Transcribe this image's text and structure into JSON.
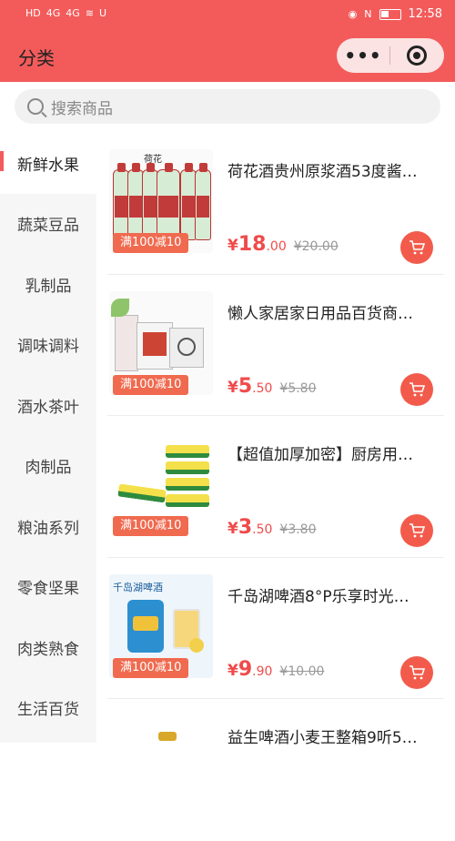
{
  "status_bar": {
    "left_icons": [
      "HD",
      "4G",
      "4G",
      "wifi",
      "U"
    ],
    "right_icons": [
      "eye",
      "N",
      "battery"
    ],
    "time": "12:58"
  },
  "header": {
    "title": "分类",
    "capsule_more_icon": "more-dots-icon",
    "capsule_target_icon": "target-icon",
    "bg_color": "#f35b5b"
  },
  "search": {
    "placeholder": "搜索商品"
  },
  "sidebar": {
    "active_index": 0,
    "items": [
      {
        "label": "新鲜水果"
      },
      {
        "label": "蔬菜豆品"
      },
      {
        "label": "乳制品"
      },
      {
        "label": "调味调料"
      },
      {
        "label": "酒水茶叶"
      },
      {
        "label": "肉制品"
      },
      {
        "label": "粮油系列"
      },
      {
        "label": "零食坚果"
      },
      {
        "label": "肉类熟食"
      },
      {
        "label": "生活百货"
      }
    ]
  },
  "products": [
    {
      "title": "荷花酒贵州原浆酒53度酱…",
      "promo": "满100减10",
      "currency": "¥",
      "price_int": "18",
      "price_dec": ".00",
      "old_price": "¥20.00"
    },
    {
      "title": "懒人家居家日用品百货商…",
      "promo": "满100减10",
      "currency": "¥",
      "price_int": "5",
      "price_dec": ".50",
      "old_price": "¥5.80"
    },
    {
      "title": "【超值加厚加密】厨房用…",
      "promo": "满100减10",
      "currency": "¥",
      "price_int": "3",
      "price_dec": ".50",
      "old_price": "¥3.80"
    },
    {
      "title": "千岛湖啤酒8°P乐享时光…",
      "promo": "满100减10",
      "currency": "¥",
      "price_int": "9",
      "price_dec": ".90",
      "old_price": "¥10.00"
    },
    {
      "title": "益生啤酒小麦王整箱9听5…",
      "promo": "",
      "currency": "",
      "price_int": "",
      "price_dec": "",
      "old_price": ""
    }
  ],
  "product_image_text": {
    "p1_brand": "荷花",
    "p4_brand": "千岛湖啤酒"
  },
  "colors": {
    "accent": "#f35b5b",
    "price": "#ef4b4b",
    "promo_bg": "#f06a4f"
  }
}
